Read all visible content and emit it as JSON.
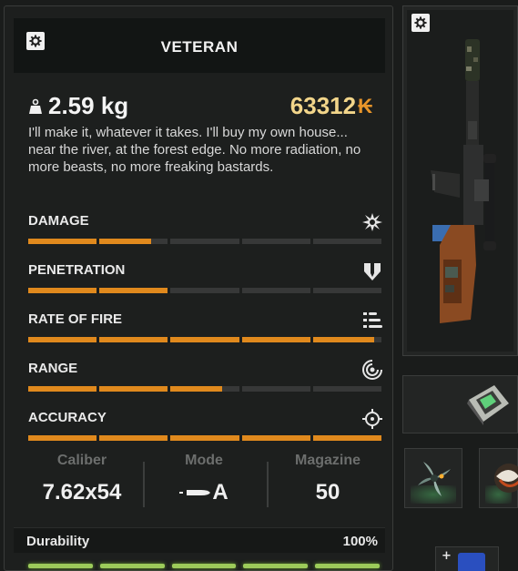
{
  "tooltip": {
    "title": "VETERAN",
    "weight": "2.59 kg",
    "price": "63312",
    "currency_symbol": "₭",
    "description": "I'll make it, whatever it takes. I'll buy my own house... near the river, at the forest edge. No more radiation, no more beasts, no more freaking bastards.",
    "stats": [
      {
        "label": "DAMAGE",
        "icon": "explosion-icon",
        "fill": 0.35
      },
      {
        "label": "PENETRATION",
        "icon": "armor-penetration-icon",
        "fill": 0.4
      },
      {
        "label": "RATE OF FIRE",
        "icon": "rate-of-fire-icon",
        "fill": 0.98
      },
      {
        "label": "RANGE",
        "icon": "range-icon",
        "fill": 0.55
      },
      {
        "label": "ACCURACY",
        "icon": "crosshair-icon",
        "fill": 1.0
      }
    ],
    "specs": {
      "caliber_label": "Caliber",
      "caliber_value": "7.62x54",
      "mode_label": "Mode",
      "mode_value": "A",
      "magazine_label": "Magazine",
      "magazine_value": "50"
    },
    "durability_label": "Durability",
    "durability_value": "100%",
    "durability_fill": 1.0
  },
  "colors": {
    "accent": "#e0891d",
    "price": "#f2d58a",
    "durability": "#9ccb5a",
    "empty_segment": "#373838"
  }
}
